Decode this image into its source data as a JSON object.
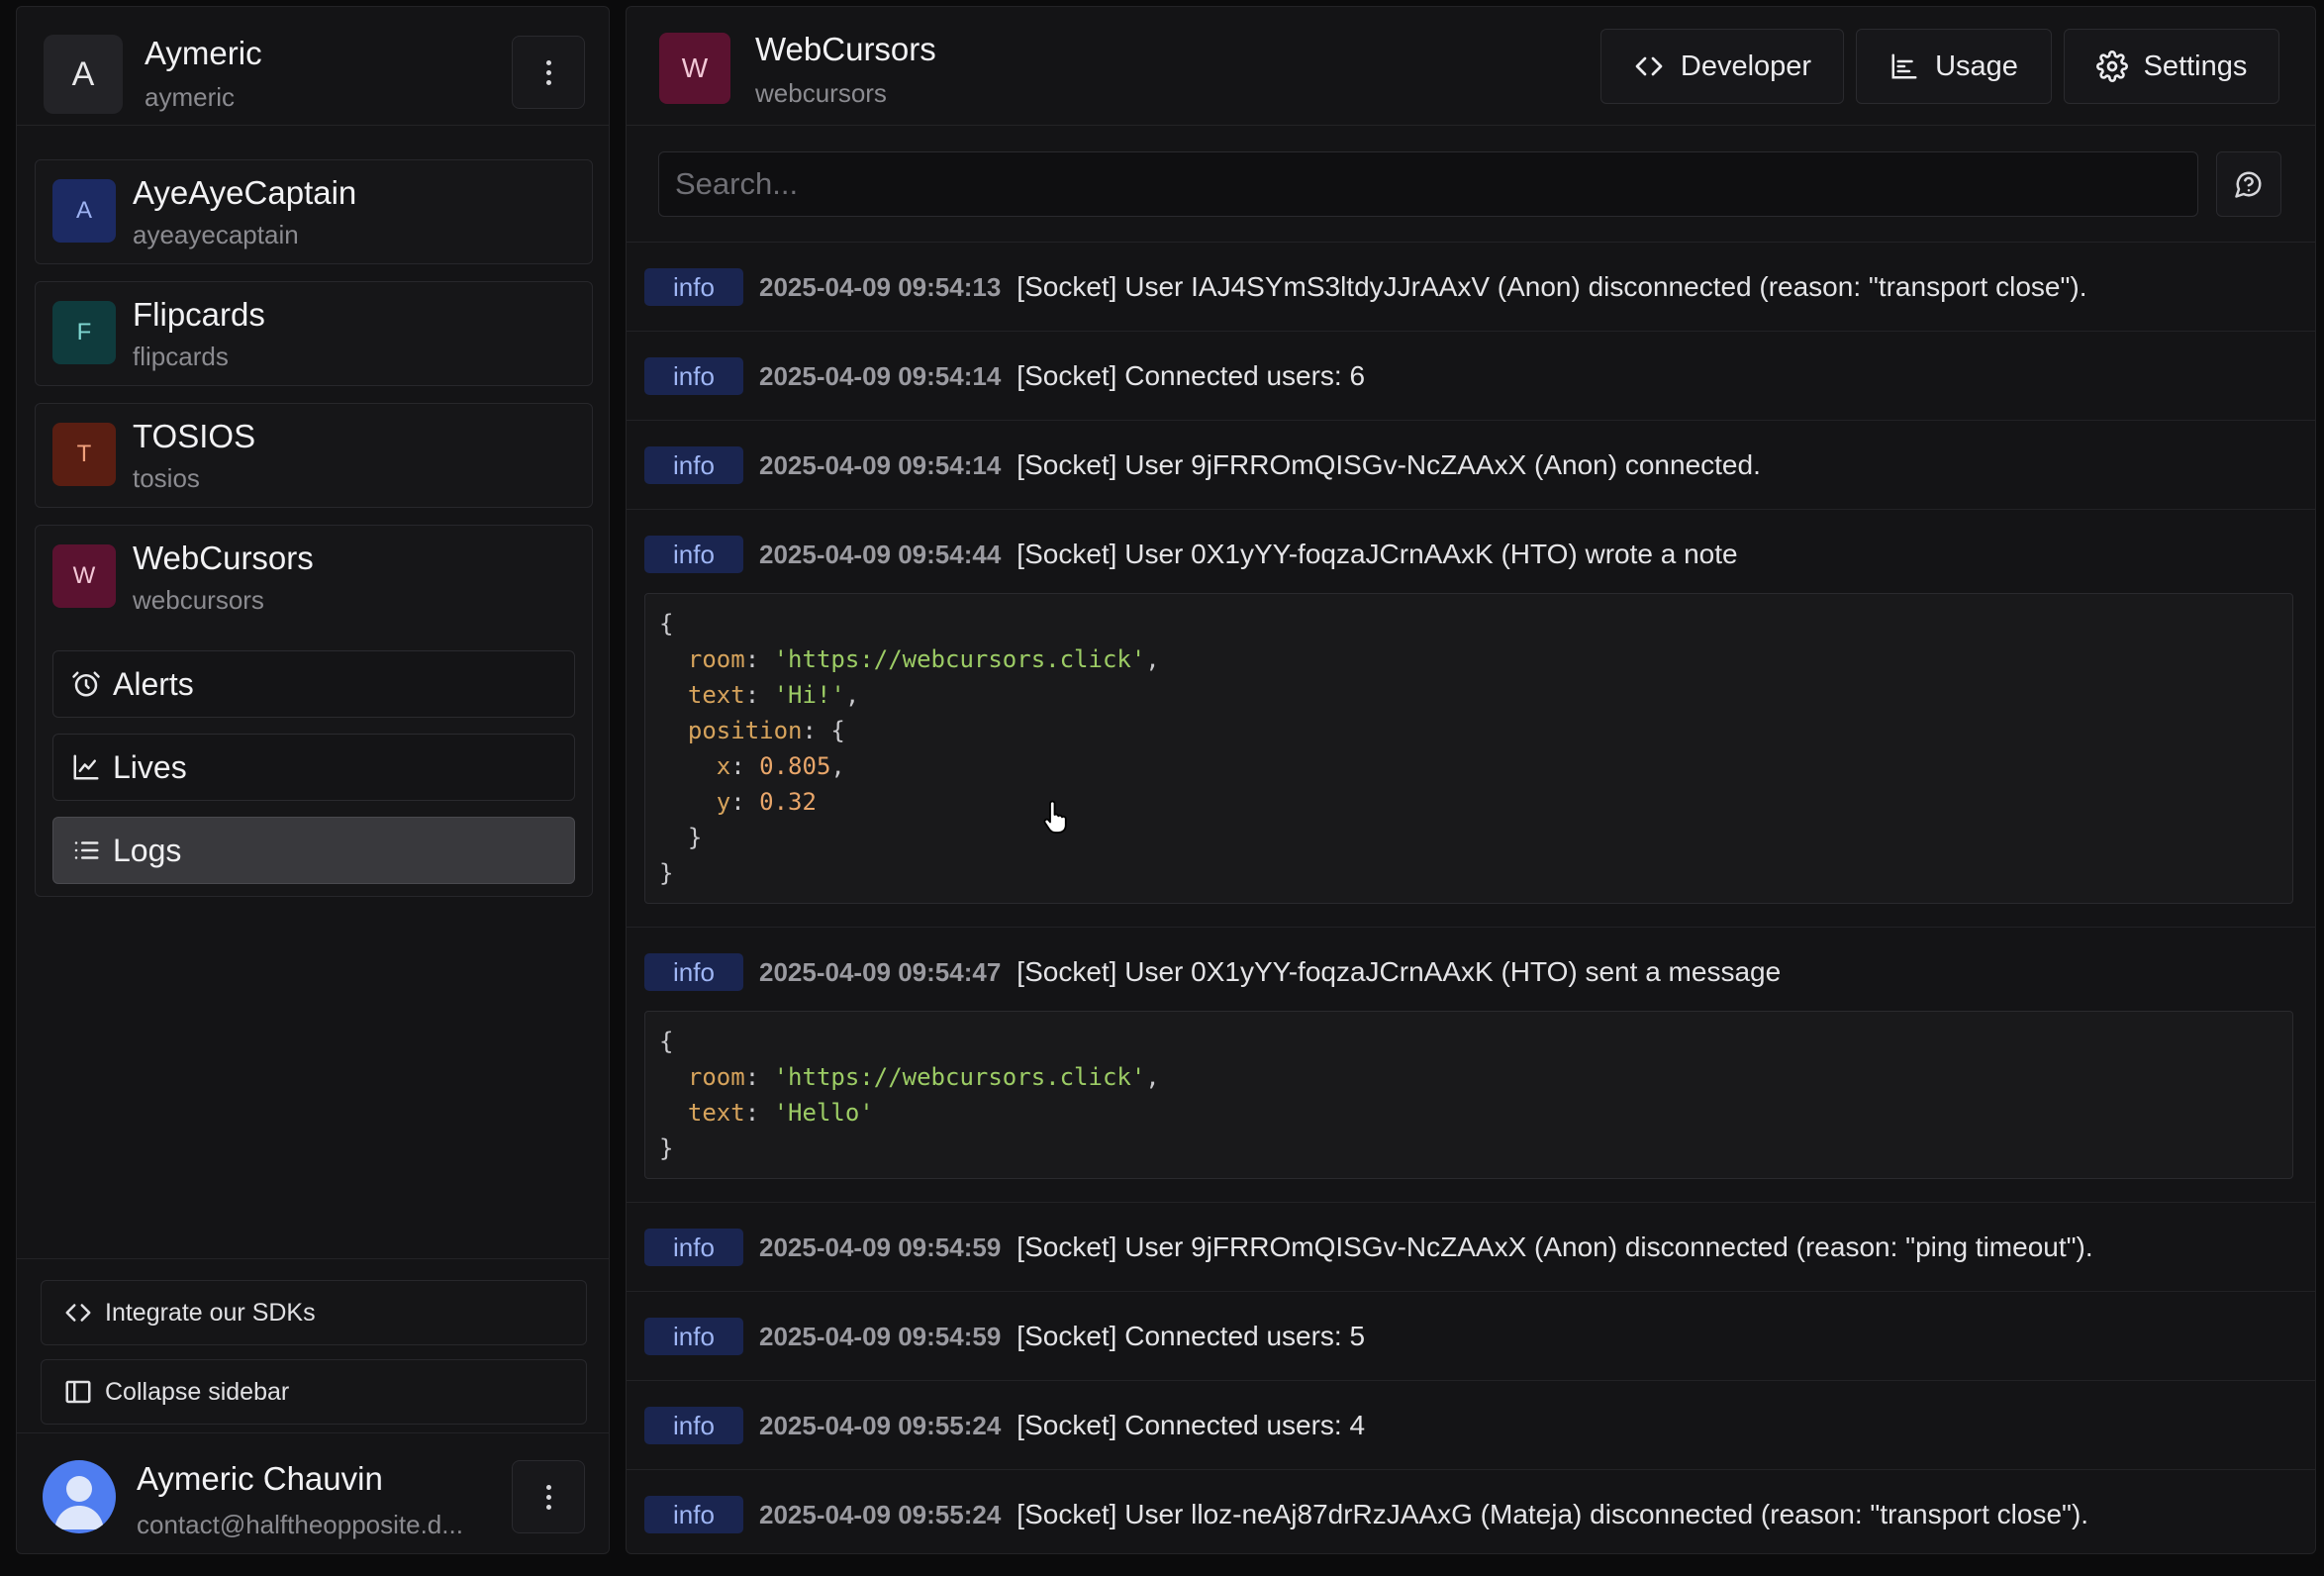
{
  "account": {
    "avatar_letter": "A",
    "name": "Aymeric",
    "handle": "aymeric"
  },
  "projects": [
    {
      "letter": "A",
      "name": "AyeAyeCaptain",
      "handle": "ayeayecaptain",
      "bg": "#1c2a63",
      "fg": "#9db2f2"
    },
    {
      "letter": "F",
      "name": "Flipcards",
      "handle": "flipcards",
      "bg": "#0f3b3d",
      "fg": "#7fd7d2"
    },
    {
      "letter": "T",
      "name": "TOSIOS",
      "handle": "tosios",
      "bg": "#5a1e12",
      "fg": "#f0a07c"
    },
    {
      "letter": "W",
      "name": "WebCursors",
      "handle": "webcursors",
      "bg": "#5b1230",
      "fg": "#f2c7d6"
    }
  ],
  "subnav": {
    "alerts": "Alerts",
    "lives": "Lives",
    "logs": "Logs",
    "active": "logs"
  },
  "sidebar_footer": {
    "integrate": "Integrate our SDKs",
    "collapse": "Collapse sidebar"
  },
  "user": {
    "name": "Aymeric Chauvin",
    "email": "contact@halftheopposite.d..."
  },
  "header": {
    "avatar_letter": "W",
    "title": "WebCursors",
    "subtitle": "webcursors",
    "developer": "Developer",
    "usage": "Usage",
    "settings": "Settings"
  },
  "search": {
    "placeholder": "Search..."
  },
  "logs": [
    {
      "level": "info",
      "time": "2025-04-09 09:54:13",
      "message": "[Socket] User IAJ4SYmS3ltdyJJrAAxV (Anon) disconnected (reason: \"transport close\")."
    },
    {
      "level": "info",
      "time": "2025-04-09 09:54:14",
      "message": "[Socket] Connected users: 6"
    },
    {
      "level": "info",
      "time": "2025-04-09 09:54:14",
      "message": "[Socket] User 9jFRROmQISGv-NcZAAxX (Anon) connected."
    },
    {
      "level": "info",
      "time": "2025-04-09 09:54:44",
      "message": "[Socket] User 0X1yYY-foqzaJCrnAAxK (HTO) wrote a note",
      "payload": {
        "room": "'https://webcursors.click'",
        "text": "'Hi!'",
        "position_x": "0.805",
        "position_y": "0.32"
      }
    },
    {
      "level": "info",
      "time": "2025-04-09 09:54:47",
      "message": "[Socket] User 0X1yYY-foqzaJCrnAAxK (HTO) sent a message",
      "payload": {
        "room": "'https://webcursors.click'",
        "text": "'Hello'"
      }
    },
    {
      "level": "info",
      "time": "2025-04-09 09:54:59",
      "message": "[Socket] User 9jFRROmQISGv-NcZAAxX (Anon) disconnected (reason: \"ping timeout\")."
    },
    {
      "level": "info",
      "time": "2025-04-09 09:54:59",
      "message": "[Socket] Connected users: 5"
    },
    {
      "level": "info",
      "time": "2025-04-09 09:55:24",
      "message": "[Socket] Connected users: 4"
    },
    {
      "level": "info",
      "time": "2025-04-09 09:55:24",
      "message": "[Socket] User lloz-neAj87drRzJAAxG (Mateja) disconnected (reason: \"transport close\")."
    }
  ]
}
